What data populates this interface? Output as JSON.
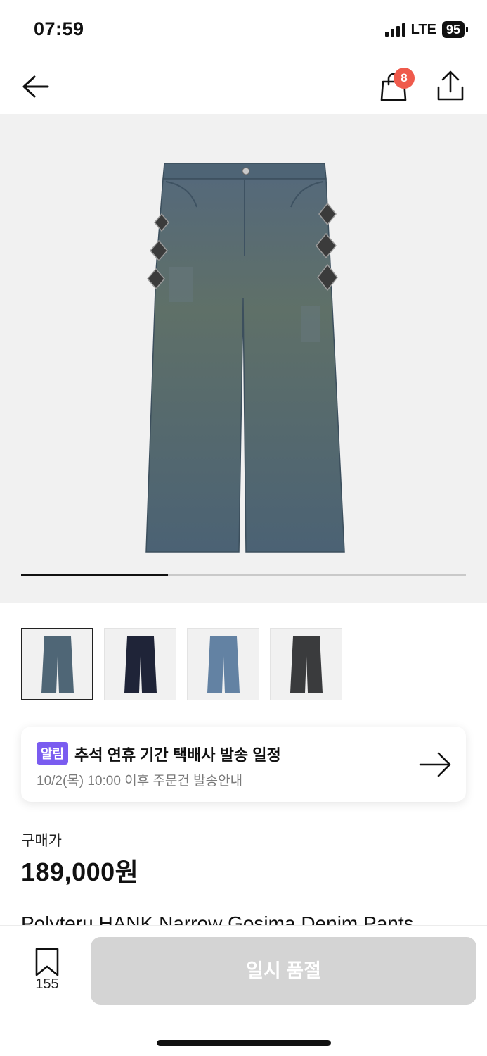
{
  "status_bar": {
    "time": "07:59",
    "network": "LTE",
    "battery": "95"
  },
  "nav": {
    "back_icon": "arrow-left-icon",
    "bag_icon": "shopping-bag-icon",
    "bag_badge": "8",
    "share_icon": "share-upload-icon"
  },
  "gallery": {
    "image": "denim-pants-photo",
    "progress": 0.33,
    "thumbnails": [
      {
        "name": "denim-pants-blue-wash",
        "color": "#4f6676",
        "active": true
      },
      {
        "name": "denim-pants-navy",
        "color": "#1f2438",
        "active": false
      },
      {
        "name": "denim-pants-light-blue",
        "color": "#6382a3",
        "active": false
      },
      {
        "name": "denim-pants-black",
        "color": "#3a3b3d",
        "active": false
      }
    ]
  },
  "notice": {
    "tag": "알림",
    "title": "추석 연휴 기간 택배사 발송 일정",
    "subtitle": "10/2(목) 10:00 이후 주문건 발송안내",
    "arrow_icon": "arrow-right-icon"
  },
  "price": {
    "label": "구매가",
    "value": "189,000원"
  },
  "product": {
    "name": "Polyteru HANK Narrow Gosima Denim Pants"
  },
  "bottom_bar": {
    "wish_icon": "bookmark-icon",
    "wish_count": "155",
    "soldout_label": "일시 품절"
  },
  "colors": {
    "accent_badge": "#ef5a4c",
    "notice_tag": "#7a5cf0",
    "disabled_button": "#d4d4d4"
  }
}
